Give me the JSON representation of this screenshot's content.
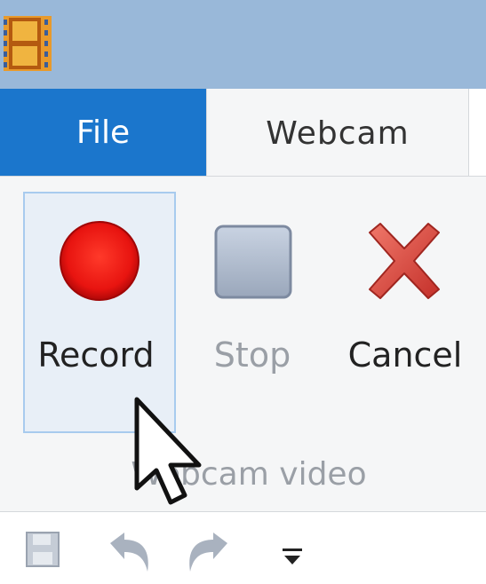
{
  "titlebar": {
    "icon": "film-strip-icon",
    "color": "#99b8d9"
  },
  "tabs": [
    {
      "label": "File",
      "icon": "",
      "active": false
    },
    {
      "label": "Webcam",
      "icon": "",
      "active": true
    }
  ],
  "ribbon": {
    "buttons": [
      {
        "label": "Record",
        "icon": "record-circle-icon",
        "enabled": true
      },
      {
        "label": "Stop",
        "icon": "stop-square-icon",
        "enabled": false
      },
      {
        "label": "Cancel",
        "icon": "cancel-x-icon",
        "enabled": true
      }
    ],
    "group_label": "Webcam video"
  },
  "quick_access": {
    "items": [
      {
        "icon": "save-icon"
      },
      {
        "icon": "undo-icon"
      },
      {
        "icon": "redo-icon"
      },
      {
        "icon": "customize-toolbar-icon"
      }
    ]
  },
  "colors": {
    "file_tab": "#1b76cc",
    "record_red": "#e81e1e",
    "cancel_red": "#d9403a"
  }
}
